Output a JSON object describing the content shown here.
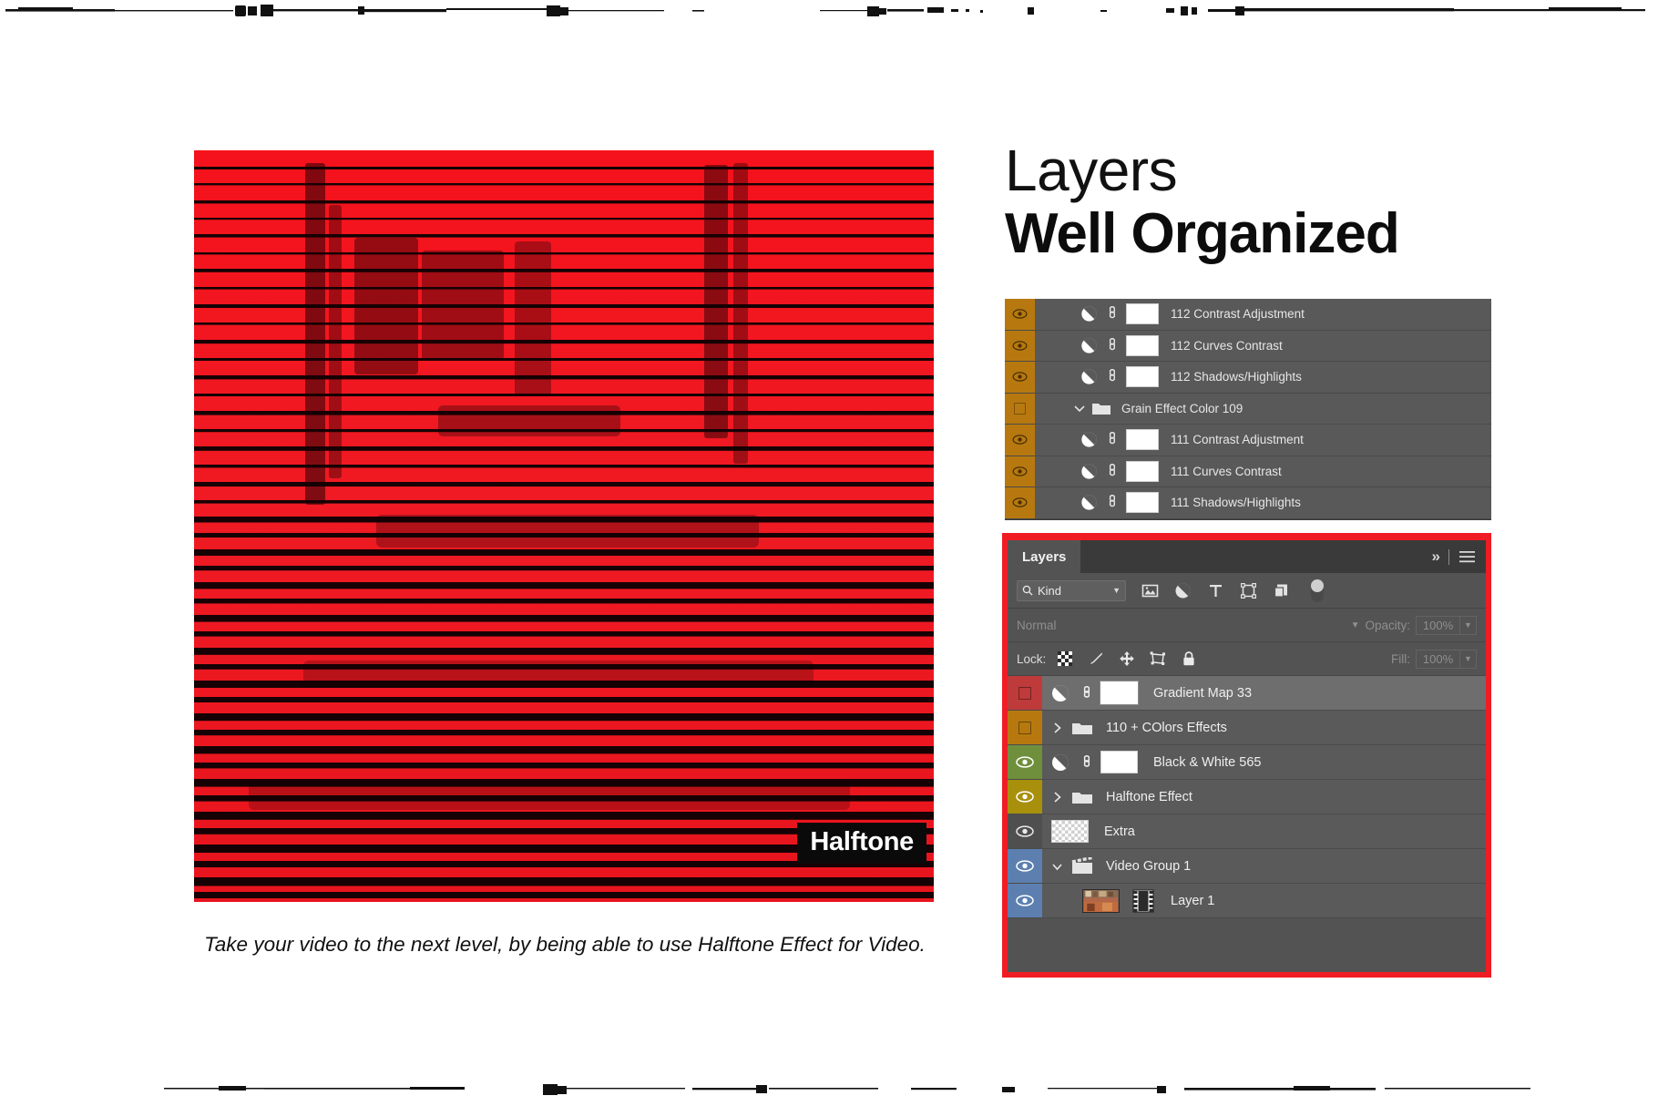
{
  "headings": {
    "title_light": "Layers",
    "title_bold": "Well Organized"
  },
  "artwork": {
    "badge_label": "Halftone",
    "caption": "Take your video to the next level, by being able to use Halftone Effect for Video.",
    "base_color": "#ee1b24",
    "stripe_color": "#1a0305"
  },
  "upper_panel": {
    "rows": [
      {
        "name": "112 Contrast Adjustment",
        "type": "adjustment",
        "visible": true,
        "swatch": "#b7790f",
        "icons": [
          "adjustment-half-circle-icon",
          "link-icon",
          "layer-mask-thumbnail"
        ]
      },
      {
        "name": "112 Curves Contrast",
        "type": "adjustment",
        "visible": true,
        "swatch": "#b7790f",
        "icons": [
          "adjustment-half-circle-icon",
          "link-icon",
          "layer-mask-thumbnail"
        ]
      },
      {
        "name": "112 Shadows/Highlights",
        "type": "adjustment",
        "visible": true,
        "swatch": "#b7790f",
        "icons": [
          "adjustment-half-circle-icon",
          "link-icon",
          "layer-mask-thumbnail"
        ]
      },
      {
        "name": "Grain Effect Color 109",
        "type": "group",
        "visible": false,
        "expanded": true,
        "swatch": "#b7790f",
        "icons": [
          "chevron-down-icon",
          "folder-icon"
        ]
      },
      {
        "name": "111 Contrast Adjustment",
        "type": "adjustment",
        "visible": true,
        "swatch": "#b7790f",
        "icons": [
          "adjustment-half-circle-icon",
          "link-icon",
          "layer-mask-thumbnail"
        ]
      },
      {
        "name": "111 Curves Contrast",
        "type": "adjustment",
        "visible": true,
        "swatch": "#b7790f",
        "icons": [
          "adjustment-half-circle-icon",
          "link-icon",
          "layer-mask-thumbnail"
        ]
      },
      {
        "name": "111 Shadows/Highlights",
        "type": "adjustment",
        "visible": true,
        "swatch": "#b7790f",
        "icons": [
          "adjustment-half-circle-icon",
          "link-icon",
          "layer-mask-thumbnail"
        ]
      }
    ]
  },
  "panel": {
    "frame_color": "#f01c24",
    "tab_label": "Layers",
    "collapse_icon": "chevron-double-right-icon",
    "menu_icon": "hamburger-menu-icon",
    "filter": {
      "kind_label": "Kind",
      "search_icon": "search-icon",
      "caret_icon": "chevron-down-icon",
      "icons": [
        "pixel-layer-filter-icon",
        "adjustment-layer-filter-icon",
        "type-layer-filter-icon",
        "shape-layer-filter-icon",
        "smart-object-filter-icon"
      ],
      "toggle_icon": "filter-enable-toggle"
    },
    "blend": {
      "mode": "Normal",
      "mode_caret": "chevron-down-icon",
      "opacity_label": "Opacity:",
      "opacity_value": "100%",
      "opacity_caret": "chevron-down-icon"
    },
    "lock": {
      "label": "Lock:",
      "icons": [
        "lock-transparent-pixels-icon",
        "lock-image-pixels-brush-icon",
        "lock-position-move-icon",
        "lock-artboard-nesting-icon",
        "lock-all-padlock-icon"
      ],
      "fill_label": "Fill:",
      "fill_value": "100%",
      "fill_caret": "chevron-down-icon"
    },
    "layers": [
      {
        "name": "Gradient Map 33",
        "type": "adjustment",
        "visible": false,
        "selected": true,
        "swatch": "#bf3b3b",
        "icons": [
          "adjustment-half-circle-icon",
          "link-icon",
          "layer-mask-thumbnail"
        ]
      },
      {
        "name": "110 + COlors Effects",
        "type": "group",
        "visible": false,
        "selected": false,
        "expanded": false,
        "swatch": "#b7790f",
        "icons": [
          "chevron-right-icon",
          "folder-icon"
        ]
      },
      {
        "name": "Black & White 565",
        "type": "adjustment",
        "visible": true,
        "selected": false,
        "swatch": "#6f8f3d",
        "icons": [
          "adjustment-half-circle-icon",
          "link-icon",
          "layer-mask-thumbnail"
        ]
      },
      {
        "name": "Halftone Effect",
        "type": "group",
        "visible": true,
        "selected": false,
        "expanded": false,
        "swatch": "#a8900d",
        "icons": [
          "chevron-right-icon",
          "folder-icon"
        ]
      },
      {
        "name": "Extra",
        "type": "pixel",
        "visible": true,
        "selected": false,
        "swatch": "#4f4f4f",
        "icons": [
          "transparent-checker-thumbnail"
        ]
      },
      {
        "name": "Video Group 1",
        "type": "video-group",
        "visible": true,
        "selected": false,
        "expanded": true,
        "swatch": "#5c7fb0",
        "icons": [
          "chevron-down-icon",
          "film-clapper-icon"
        ]
      },
      {
        "name": "Layer 1",
        "type": "video",
        "visible": true,
        "selected": false,
        "swatch": "#5c7fb0",
        "icons": [
          "video-thumbnail",
          "film-strip-icon"
        ]
      }
    ]
  }
}
